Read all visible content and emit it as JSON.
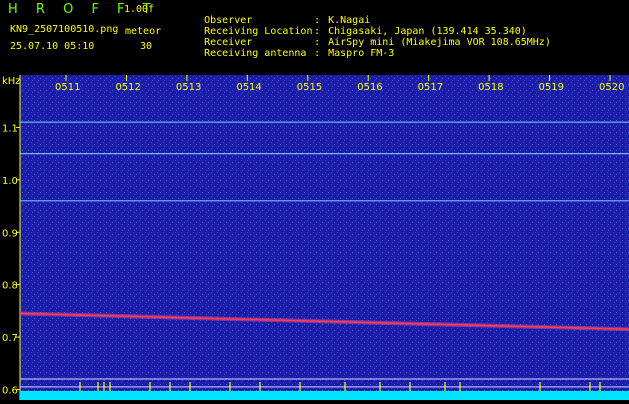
{
  "header": {
    "app_title": "H R O F F T",
    "version": "1.00f",
    "filename": "KN9_2507100510.png",
    "datetime": "25.07.10 05:10",
    "mode_label": "meteor",
    "mode_value": "30"
  },
  "metadata": [
    {
      "key": "Observer",
      "value": "K.Nagai"
    },
    {
      "key": "Receiving Location",
      "value": "Chigasaki, Japan (139.414 35.340)"
    },
    {
      "key": "Receiver",
      "value": "AirSpy mini (Miakejima VOR 108.65MHz)"
    },
    {
      "key": "Receiving antenna",
      "value": "Maspro FM-3"
    }
  ],
  "colors": {
    "background": "#1c1ea8",
    "text": "#ffff00",
    "title": "#66ff00",
    "signal_line": "#7fd6ff",
    "echo_trace": "#ff4040",
    "noise_floor": "#00e5ff"
  },
  "chart_data": {
    "type": "heatmap",
    "ylabel": "kHz",
    "y_ticks": [
      "1.1",
      "1.0",
      "0.9",
      "0.8",
      "0.7",
      "0.6"
    ],
    "y_values": [
      1.1,
      1.0,
      0.9,
      0.8,
      0.7,
      0.6
    ],
    "ylim": [
      0.58,
      1.2
    ],
    "x_ticks": [
      "0511",
      "0512",
      "0513",
      "0514",
      "0515",
      "0516",
      "0517",
      "0518",
      "0519",
      "0520"
    ],
    "horizontal_lines_khz": [
      1.11,
      1.05,
      0.96,
      0.62,
      0.605
    ],
    "echo_trace": {
      "start_khz": 0.745,
      "end_khz": 0.715
    }
  }
}
